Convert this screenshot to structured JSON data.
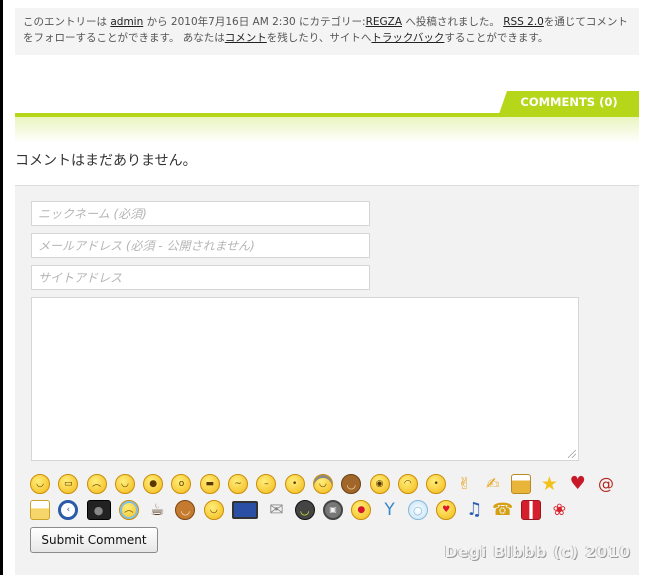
{
  "postmeta": {
    "t1": "このエントリーは ",
    "author": "admin",
    "t2": " から 2010年7月16日 AM 2:30 にカテゴリー:",
    "category": "REGZA",
    "t3": " へ投稿されました。 ",
    "rss": "RSS 2.0",
    "t4": "を通じてコメントをフォローすることができます。 あなたは",
    "comment_link": "コメント",
    "t5": "を残したり、サイトへ",
    "trackback": "トラックバック",
    "t6": "することができます。"
  },
  "comments": {
    "tab_label": "COMMENTS (0)",
    "empty_message": "コメントはまだありません。",
    "accent_color": "#b6d61a"
  },
  "form": {
    "name_placeholder": "ニックネーム (必須)",
    "email_placeholder": "メールアドレス (必須 - 公開されません)",
    "url_placeholder": "サイトアドレス",
    "submit_label": "Submit Comment"
  },
  "smilies": {
    "row1": [
      "smile-icon",
      "grin-icon",
      "sad-icon",
      "wink-icon",
      "tongue-icon",
      "surprised-icon",
      "cool-icon",
      "confused-icon",
      "neutral-icon",
      "blush-icon",
      "headphones-icon",
      "monkey-icon",
      "cyclops-icon",
      "worried-icon",
      "kiss-icon",
      "thumbs-up-icon",
      "thumbs-down-icon",
      "beer-icon",
      "star-icon",
      "broken-heart-icon",
      "snail-icon"
    ],
    "row2": [
      "cake-icon",
      "clock-icon",
      "camera-icon",
      "crying-icon",
      "coffee-icon",
      "dog-icon",
      "happy-icon",
      "tv-icon",
      "mail-icon",
      "cat-icon",
      "film-icon",
      "kiss-lips-icon",
      "cocktail-icon",
      "lightbulb-icon",
      "love-eyes-icon",
      "music-note-icon",
      "phone-icon",
      "gift-icon",
      "tulip-icon"
    ]
  },
  "watermark": "Degi Blbbb (c) 2010"
}
